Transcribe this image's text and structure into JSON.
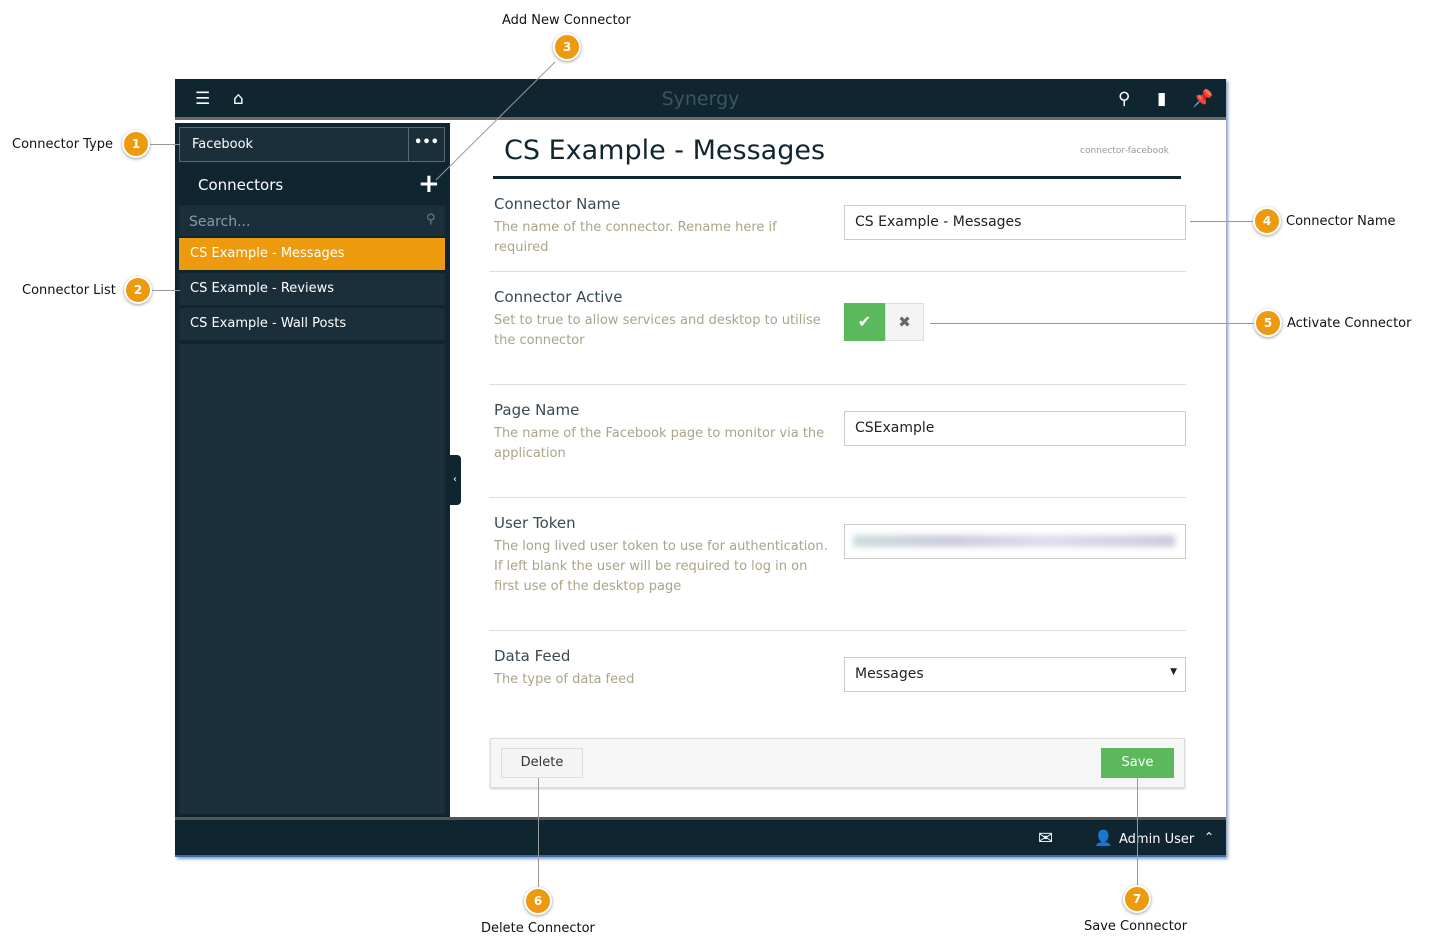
{
  "app": {
    "title": "Synergy"
  },
  "topbar": {
    "icons": [
      "menu-icon",
      "home-icon",
      "search-icon",
      "bookmark-icon",
      "pin-icon"
    ]
  },
  "sidebar": {
    "connector_type": "Facebook",
    "more": "•••",
    "heading": "Connectors",
    "search_placeholder": "Search...",
    "items": [
      {
        "label": "CS Example - Messages",
        "active": true
      },
      {
        "label": "CS Example - Reviews"
      },
      {
        "label": "CS Example - Wall Posts"
      }
    ]
  },
  "main": {
    "title": "CS Example - Messages",
    "slug": "connector-facebook",
    "fields": {
      "name": {
        "label": "Connector Name",
        "desc": "The name of the connector. Rename here if required",
        "value": "CS Example - Messages"
      },
      "active": {
        "label": "Connector Active",
        "desc": "Set to true to allow services and desktop to utilise the connector",
        "value": true
      },
      "page": {
        "label": "Page Name",
        "desc": "The name of the Facebook page to monitor via the application",
        "value": "CSExample"
      },
      "token": {
        "label": "User Token",
        "desc": "The long lived user token to use for authentication. If left blank the user will be required to log in on first use of the desktop page"
      },
      "feed": {
        "label": "Data Feed",
        "desc": "The type of data feed",
        "value": "Messages"
      }
    },
    "delete_label": "Delete",
    "save_label": "Save"
  },
  "bottombar": {
    "user": "Admin User"
  },
  "colors": {
    "accent": "#ee9a0e",
    "success": "#5cb85c",
    "nav": "#0f2631"
  },
  "callouts": [
    {
      "n": "1",
      "text": "Connector Type"
    },
    {
      "n": "2",
      "text": "Connector List"
    },
    {
      "n": "3",
      "text": "Add New Connector"
    },
    {
      "n": "4",
      "text": "Connector Name"
    },
    {
      "n": "5",
      "text": "Activate Connector"
    },
    {
      "n": "6",
      "text": "Delete Connector"
    },
    {
      "n": "7",
      "text": "Save Connector"
    }
  ]
}
